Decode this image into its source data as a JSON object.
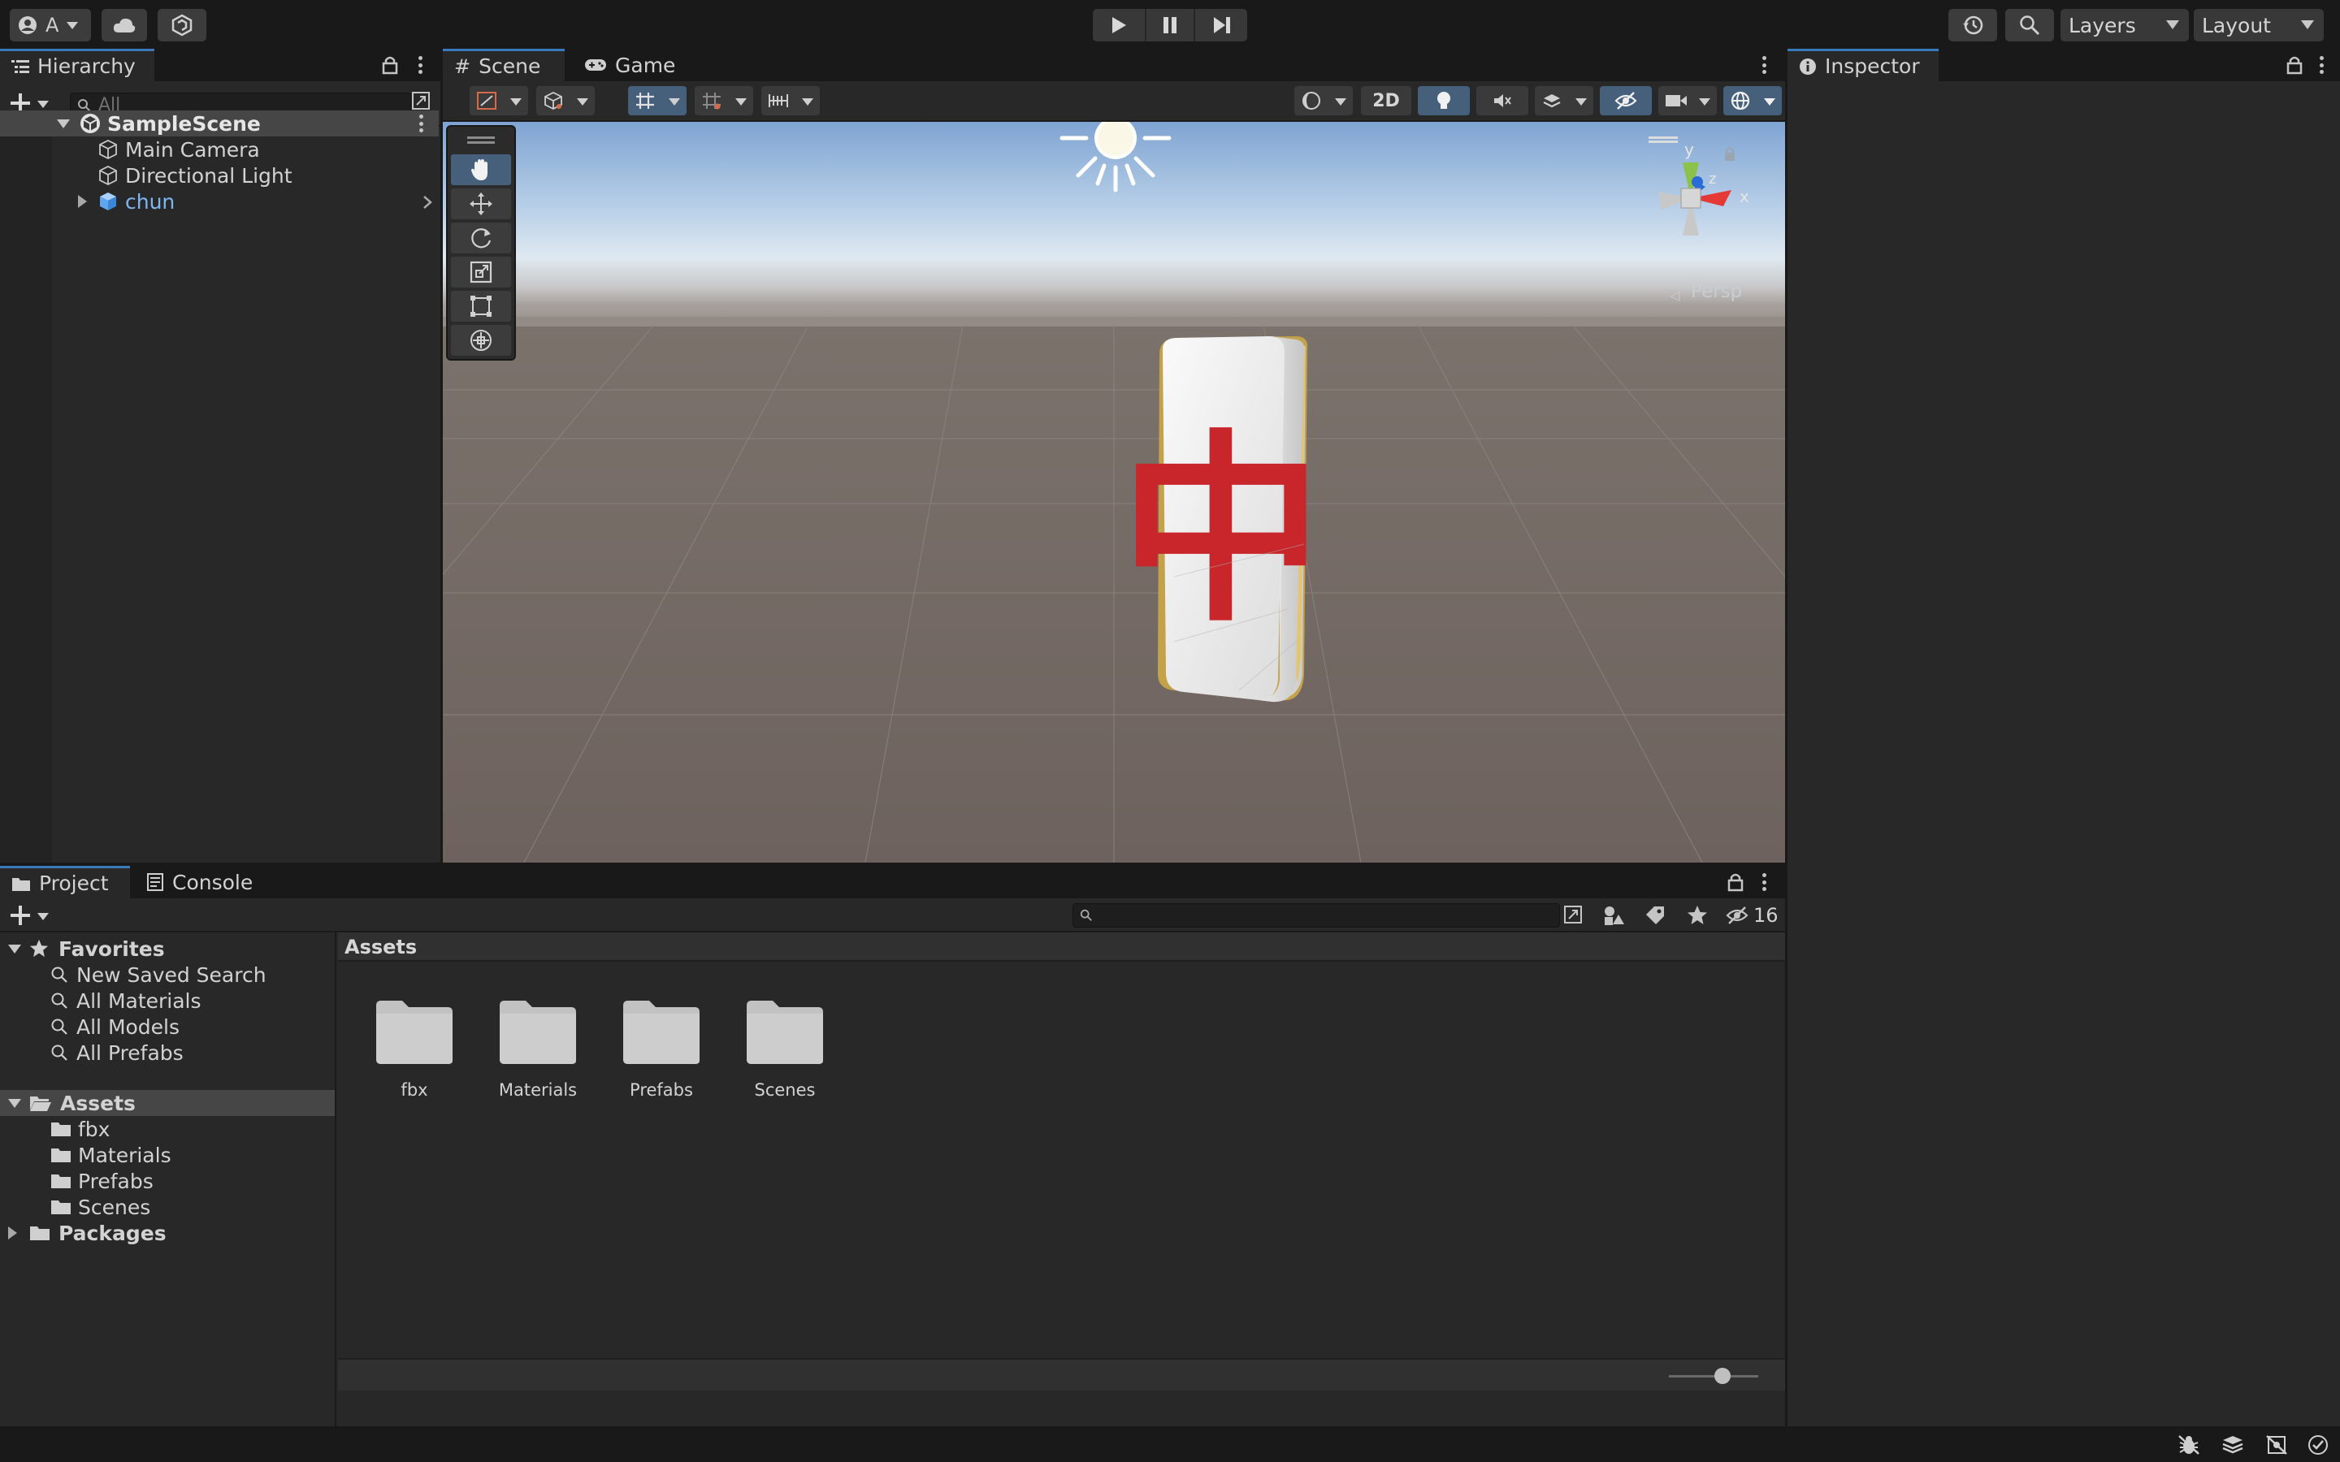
{
  "toolbar": {
    "account_initial": "A",
    "layers_label": "Layers",
    "layout_label": "Layout"
  },
  "hierarchy": {
    "tab_label": "Hierarchy",
    "search_placeholder": "All",
    "scene_name": "SampleScene",
    "items": [
      {
        "label": "Main Camera"
      },
      {
        "label": "Directional Light"
      },
      {
        "label": "chun"
      }
    ]
  },
  "scene": {
    "tab_scene": "Scene",
    "tab_game": "Game",
    "btn_2d": "2D",
    "gizmo_y": "y",
    "gizmo_z": "z",
    "gizmo_x": "x",
    "persp_label": "Persp",
    "tile_glyph": "中"
  },
  "inspector": {
    "tab_label": "Inspector"
  },
  "project": {
    "tab_project": "Project",
    "tab_console": "Console",
    "hidden_count": "16",
    "favorites_label": "Favorites",
    "favorites": [
      "New Saved Search",
      "All Materials",
      "All Models",
      "All Prefabs"
    ],
    "assets_label": "Assets",
    "asset_folders": [
      "fbx",
      "Materials",
      "Prefabs",
      "Scenes"
    ],
    "packages_label": "Packages",
    "breadcrumb": "Assets",
    "grid_folders": [
      "fbx",
      "Materials",
      "Prefabs",
      "Scenes"
    ],
    "zoom_level": 0.6
  },
  "colors": {
    "accent_blue": "#3a79bb",
    "selected_row": "#46607c",
    "tile_red": "#c8262b",
    "prefab_blue": "#7fb6f2"
  },
  "icons": [
    "account-icon",
    "cloud-icon",
    "collab-icon",
    "play-icon",
    "pause-icon",
    "step-icon",
    "history-icon",
    "search-icon",
    "hierarchy-icon",
    "lock-icon",
    "plus-icon",
    "unity-scene-icon",
    "gameobject-icon",
    "prefab-cube-icon",
    "hand-tool-icon",
    "move-tool-icon",
    "rotate-tool-icon",
    "scale-tool-icon",
    "rect-tool-icon",
    "transform-tool-icon",
    "sun-icon",
    "info-icon",
    "folder-icon",
    "star-icon",
    "tag-icon",
    "eye-slash-icon",
    "bug-icon",
    "layers-stack-icon",
    "network-icon",
    "check-icon"
  ]
}
